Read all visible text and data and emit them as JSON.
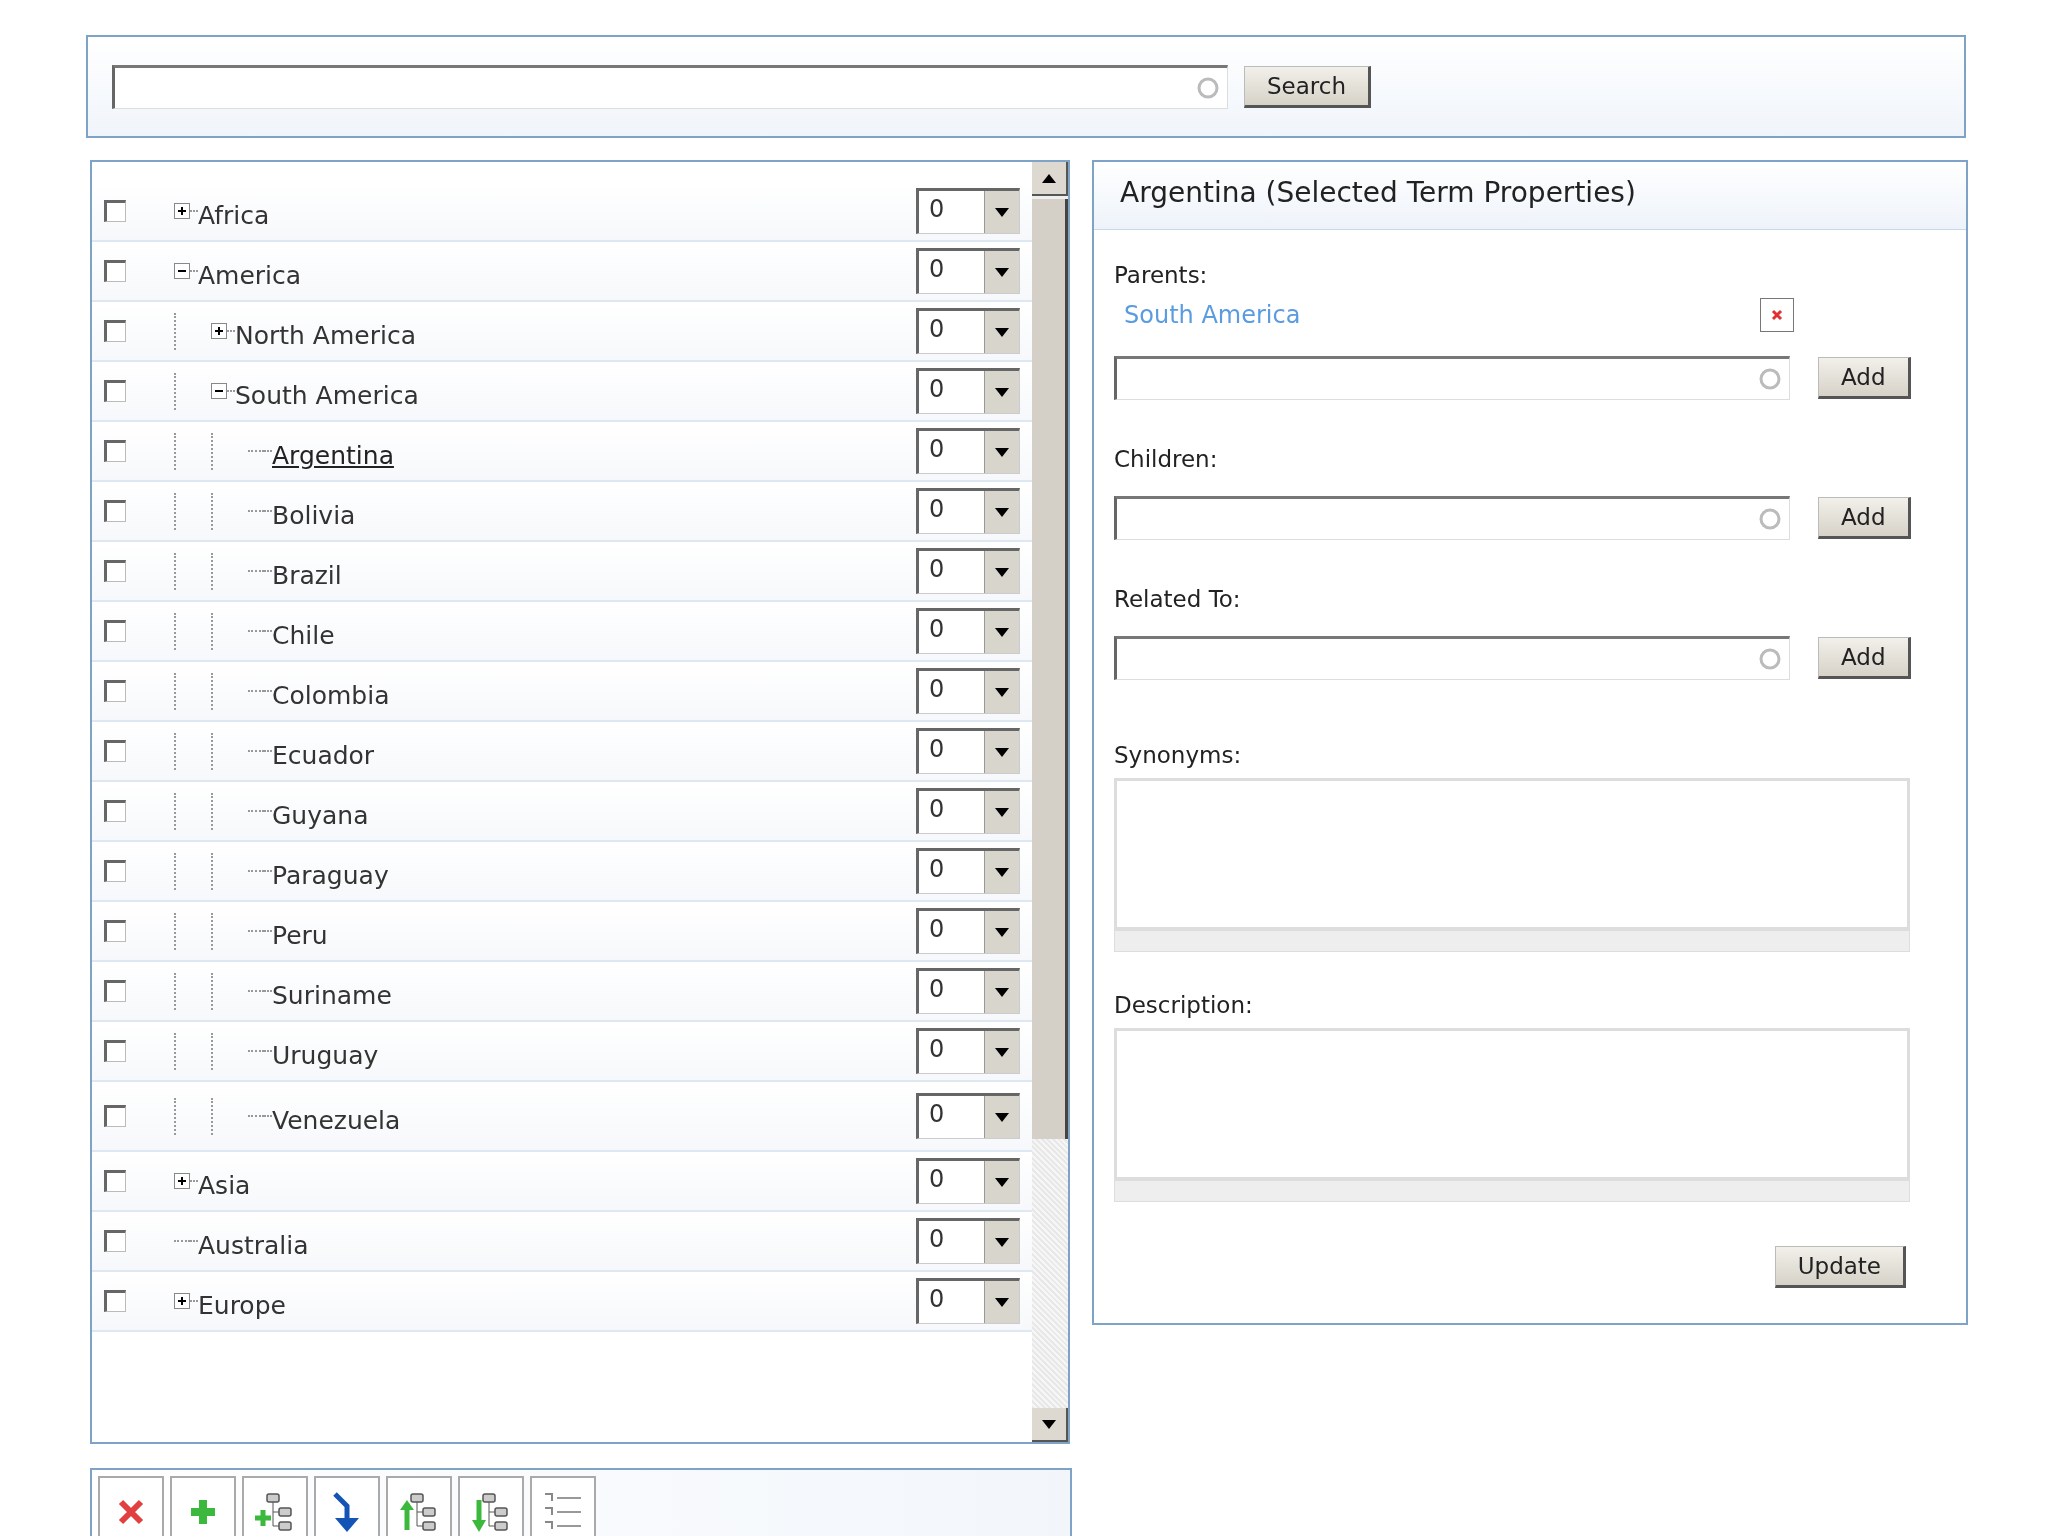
{
  "search": {
    "button": "Search"
  },
  "tree": [
    {
      "label": "Africa",
      "checked": false,
      "expanded": false,
      "selected": false,
      "weight": "0"
    },
    {
      "label": "America",
      "checked": false,
      "expanded": true,
      "selected": false,
      "weight": "0",
      "children": [
        {
          "label": "North America",
          "checked": false,
          "expanded": false,
          "selected": false,
          "weight": "0"
        },
        {
          "label": "South America",
          "checked": false,
          "expanded": true,
          "selected": false,
          "weight": "0",
          "children": [
            {
              "label": "Argentina",
              "checked": false,
              "selected": true,
              "weight": "0"
            },
            {
              "label": "Bolivia",
              "checked": false,
              "selected": false,
              "weight": "0"
            },
            {
              "label": "Brazil",
              "checked": false,
              "selected": false,
              "weight": "0"
            },
            {
              "label": "Chile",
              "checked": false,
              "selected": false,
              "weight": "0"
            },
            {
              "label": "Colombia",
              "checked": false,
              "selected": false,
              "weight": "0"
            },
            {
              "label": "Ecuador",
              "checked": false,
              "selected": false,
              "weight": "0"
            },
            {
              "label": "Guyana",
              "checked": false,
              "selected": false,
              "weight": "0"
            },
            {
              "label": "Paraguay",
              "checked": false,
              "selected": false,
              "weight": "0"
            },
            {
              "label": "Peru",
              "checked": false,
              "selected": false,
              "weight": "0"
            },
            {
              "label": "Suriname",
              "checked": false,
              "selected": false,
              "weight": "0"
            },
            {
              "label": "Uruguay",
              "checked": false,
              "selected": false,
              "weight": "0"
            },
            {
              "label": "Venezuela",
              "checked": false,
              "selected": false,
              "weight": "0"
            }
          ]
        }
      ]
    },
    {
      "label": "Asia",
      "checked": false,
      "expanded": false,
      "selected": false,
      "weight": "0"
    },
    {
      "label": "Australia",
      "checked": false,
      "selected": false,
      "weight": "0"
    },
    {
      "label": "Europe",
      "checked": false,
      "expanded": false,
      "selected": false,
      "weight": "0"
    }
  ],
  "toolbar": [
    {
      "kind": "delete"
    },
    {
      "kind": "add"
    },
    {
      "kind": "add-child"
    },
    {
      "kind": "move-down"
    },
    {
      "kind": "move-up-level"
    },
    {
      "kind": "move-down-level"
    },
    {
      "kind": "list"
    }
  ],
  "properties": {
    "title": "Argentina (Selected Term Properties)",
    "parents_label": "Parents:",
    "parents": [
      "South America"
    ],
    "fields": [
      {
        "kind": "lookup",
        "add_button": "Add"
      },
      {
        "kind": "lookup",
        "label": "Children:",
        "add_button": "Add"
      },
      {
        "kind": "lookup",
        "label": "Related To:",
        "add_button": "Add"
      }
    ],
    "synonyms_label": "Synonyms:",
    "description_label": "Description:",
    "update_button": "Update"
  }
}
